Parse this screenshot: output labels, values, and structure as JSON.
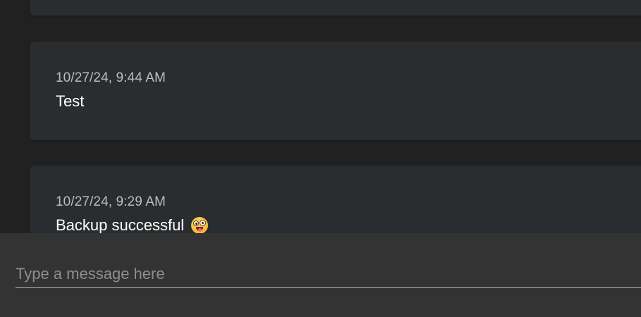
{
  "messages": [
    {
      "timestamp": "10/27/24, 9:44 AM",
      "text": "Test"
    },
    {
      "timestamp": "10/27/24, 9:29 AM",
      "text": "Backup successful",
      "emoji": "grinning-zany-face-emoji"
    }
  ],
  "composer": {
    "placeholder": "Type a message here"
  },
  "colors": {
    "page_background": "#212121",
    "card_background": "#292d30",
    "composer_background": "#333333",
    "timestamp_text": "#b9bdc0",
    "message_text": "#ffffff"
  }
}
